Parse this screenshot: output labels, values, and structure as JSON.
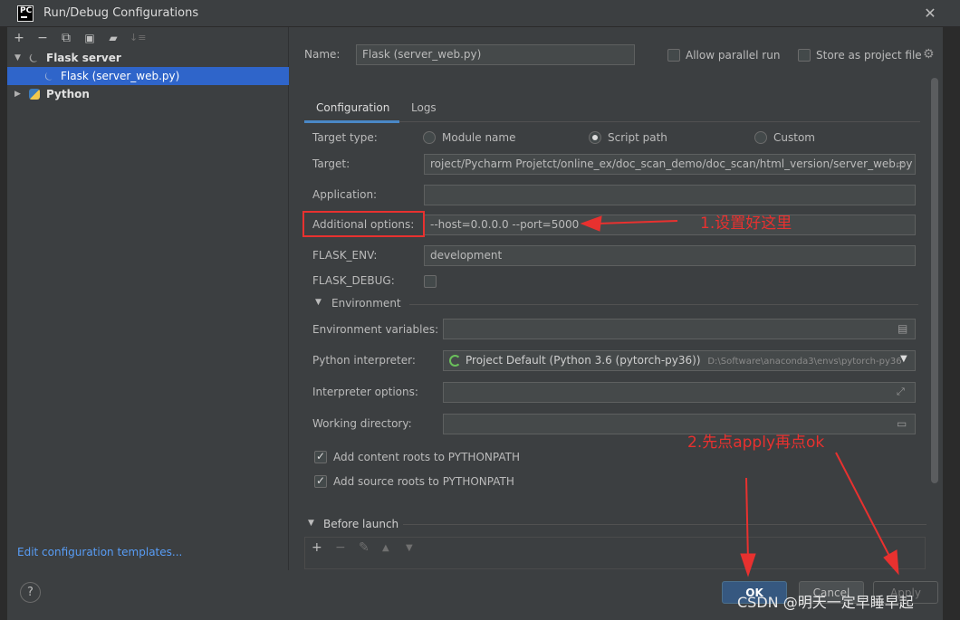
{
  "window": {
    "title": "Run/Debug Configurations",
    "app_icon_text": "PC",
    "close_icon": "close-icon"
  },
  "tree": {
    "toolbar_icons": [
      "add-icon",
      "remove-icon",
      "copy-icon",
      "save-icon",
      "new-folder-icon",
      "sort-icon"
    ],
    "flask_group": "Flask server",
    "flask_item": "Flask (server_web.py)",
    "python_group": "Python",
    "edit_templates": "Edit configuration templates..."
  },
  "header": {
    "name_label": "Name:",
    "name_value": "Flask (server_web.py)",
    "parallel_label": "Allow parallel run",
    "store_label": "Store as project file"
  },
  "tabs": [
    {
      "label": "Configuration",
      "active": true
    },
    {
      "label": "Logs",
      "active": false
    }
  ],
  "config": {
    "target_type_label": "Target type:",
    "radio_module": "Module name",
    "radio_script": "Script path",
    "radio_custom": "Custom",
    "selected_target_type": "Script path",
    "target_label": "Target:",
    "target_value": "roject/Pycharm Projetct/online_ex/doc_scan_demo/doc_scan/html_version/server_web.py",
    "application_label": "Application:",
    "application_value": "",
    "additional_label": "Additional options:",
    "additional_value": "--host=0.0.0.0 --port=5000",
    "flask_env_label": "FLASK_ENV:",
    "flask_env_value": "development",
    "flask_debug_label": "FLASK_DEBUG:",
    "flask_debug_checked": false,
    "environment_section": "Environment",
    "env_vars_label": "Environment variables:",
    "env_vars_value": "",
    "interpreter_label": "Python interpreter:",
    "interpreter_value": "Project Default (Python 3.6 (pytorch-py36))",
    "interpreter_path": "D:\\Software\\anaconda3\\envs\\pytorch-py36",
    "interpreter_options_label": "Interpreter options:",
    "interpreter_options_value": "",
    "working_dir_label": "Working directory:",
    "working_dir_value": "",
    "content_roots_label": "Add content roots to PYTHONPATH",
    "content_roots_checked": true,
    "source_roots_label": "Add source roots to PYTHONPATH",
    "source_roots_checked": true,
    "before_launch_label": "Before launch"
  },
  "buttons": {
    "help": "?",
    "ok": "OK",
    "cancel": "Cancel",
    "apply": "Apply"
  },
  "annotations": {
    "note1": "1.设置好这里",
    "note2": "2.先点apply再点ok",
    "color": "#e8312f"
  },
  "watermark": "CSDN @明天一定早睡早起",
  "colors": {
    "selection": "#2f65ca",
    "ok_button": "#365880",
    "link": "#589df6"
  }
}
